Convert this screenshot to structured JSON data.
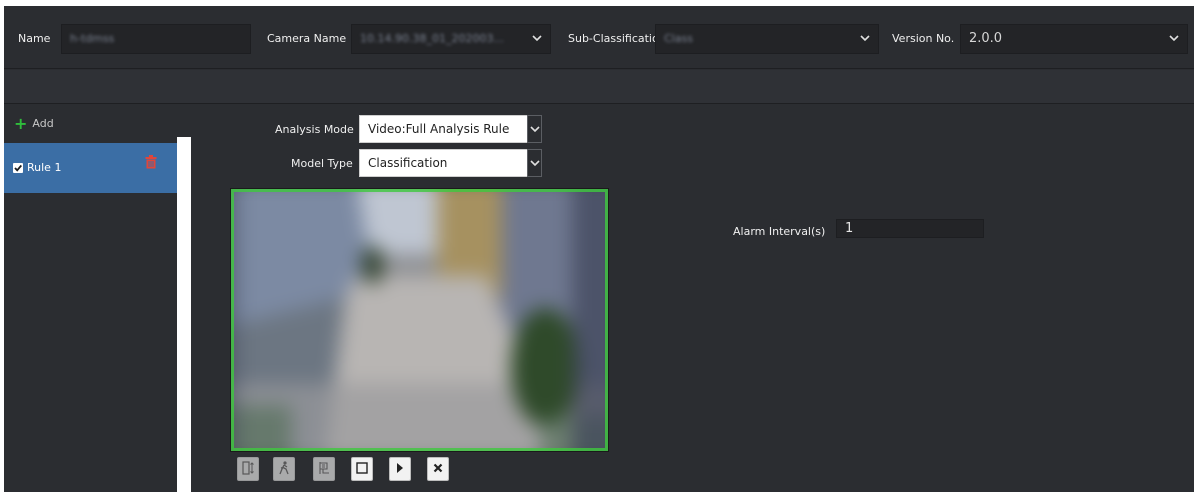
{
  "header": {
    "name_label": "Name",
    "name_value": "h-tdmss",
    "camera_label": "Camera Name",
    "camera_value": "10.14.90.38_01_202003...",
    "subclass_label": "Sub-Classification",
    "subclass_value": "Class",
    "version_label": "Version No.",
    "version_value": "2.0.0"
  },
  "sidebar": {
    "add_label": "Add",
    "rules": [
      {
        "label": "Rule 1",
        "checked": true
      }
    ]
  },
  "form": {
    "analysis_mode_label": "Analysis Mode",
    "analysis_mode_value": "Video:Full Analysis Rule",
    "model_type_label": "Model Type",
    "model_type_value": "Classification",
    "alarm_interval_label": "Alarm Interval(s)",
    "alarm_interval_value": "1"
  },
  "toolbar": {
    "buttons": [
      {
        "icon": "height-icon",
        "enabled": false
      },
      {
        "icon": "person-icon",
        "enabled": false
      },
      {
        "icon": "frame-icon",
        "enabled": false
      },
      {
        "icon": "square-icon",
        "enabled": true
      },
      {
        "icon": "play-icon",
        "enabled": true
      },
      {
        "icon": "close-icon",
        "enabled": true
      }
    ]
  },
  "colors": {
    "background": "#2b2d31",
    "selected_rule": "#3b6ea5",
    "add_icon": "#2fbd3b",
    "delete_icon": "#e0463b",
    "video_border": "#3ec93e"
  }
}
